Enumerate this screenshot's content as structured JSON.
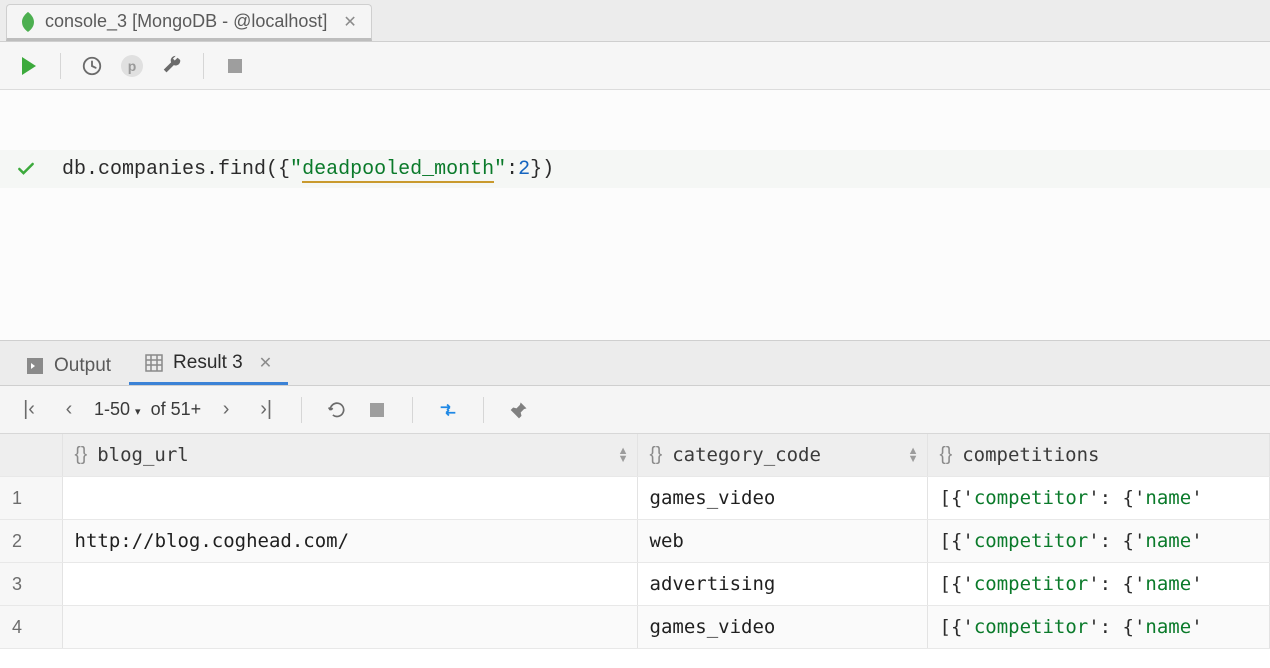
{
  "tab": {
    "title": "console_3 [MongoDB - @localhost]"
  },
  "editor": {
    "code_prefix": "db.companies.find({",
    "code_quote1": "\"",
    "code_field": "deadpooled_month",
    "code_quote2": "\"",
    "code_colon": ":",
    "code_value": "2",
    "code_suffix": "})"
  },
  "result_tabs": {
    "output_label": "Output",
    "result_label": "Result 3"
  },
  "pager": {
    "range": "1-50",
    "of": "of 51+",
    "range_sep": "▾"
  },
  "columns": {
    "c1": "blog_url",
    "c2": "category_code",
    "c3": "competitions"
  },
  "rows": [
    {
      "n": "1",
      "blog_url": "",
      "category_code": "games_video",
      "comp": "[{'competitor': {'name'"
    },
    {
      "n": "2",
      "blog_url": "http://blog.coghead.com/",
      "category_code": "web",
      "comp": "[{'competitor': {'name'"
    },
    {
      "n": "3",
      "blog_url": "",
      "category_code": "advertising",
      "comp": "[{'competitor': {'name'"
    },
    {
      "n": "4",
      "blog_url": "",
      "category_code": "games_video",
      "comp": "[{'competitor': {'name'"
    }
  ]
}
